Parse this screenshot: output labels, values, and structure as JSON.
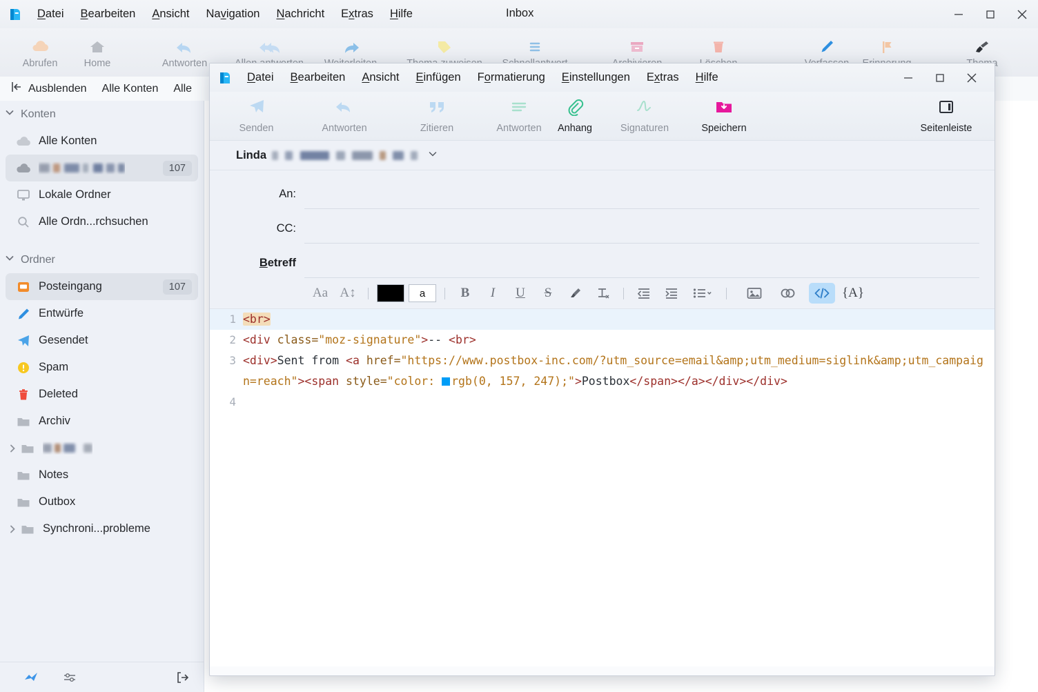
{
  "main_window": {
    "title": "Inbox",
    "menu": [
      {
        "label": "Datei",
        "accel": "D"
      },
      {
        "label": "Bearbeiten",
        "accel": "B"
      },
      {
        "label": "Ansicht",
        "accel": "A"
      },
      {
        "label": "Navigation",
        "accel": "v"
      },
      {
        "label": "Nachricht",
        "accel": "N"
      },
      {
        "label": "Extras",
        "accel": "x"
      },
      {
        "label": "Hilfe",
        "accel": "H"
      }
    ],
    "window_controls": [
      "minimize",
      "maximize",
      "close"
    ],
    "toolbar": [
      {
        "label": "Abrufen",
        "icon": "cloud-download-icon"
      },
      {
        "label": "Home",
        "icon": "home-icon"
      },
      {
        "label": "Antworten",
        "icon": "reply-icon"
      },
      {
        "label": "Allen antworten",
        "icon": "reply-all-icon"
      },
      {
        "label": "Weiterleiten",
        "icon": "forward-icon"
      },
      {
        "label": "Thema zuweisen",
        "icon": "tag-icon"
      },
      {
        "label": "Schnellantwort",
        "icon": "quick-reply-icon"
      },
      {
        "label": "Archivieren",
        "icon": "archive-icon"
      },
      {
        "label": "Löschen",
        "icon": "trash-icon"
      },
      {
        "label": "Verfassen",
        "icon": "compose-pencil-icon"
      },
      {
        "label": "Erinnerung",
        "icon": "flag-icon"
      },
      {
        "label": "Thema",
        "icon": "paintbrush-icon"
      }
    ],
    "subbar": [
      {
        "label": "Ausblenden",
        "icon": "collapse-icon"
      },
      {
        "label": "Alle Konten",
        "icon": "none"
      },
      {
        "label": "Alle",
        "icon": "none"
      }
    ],
    "sidebar": {
      "sections": [
        {
          "title": "Konten",
          "items": [
            {
              "label": "Alle Konten",
              "icon": "cloud-icon",
              "badge": "",
              "selected": false,
              "redacted": false,
              "chevron": false
            },
            {
              "label": "",
              "icon": "cloud-icon",
              "badge": "107",
              "selected": true,
              "redacted": true,
              "chevron": false
            },
            {
              "label": "Lokale Ordner",
              "icon": "monitor-icon",
              "badge": "",
              "selected": false,
              "redacted": false,
              "chevron": false
            },
            {
              "label": "Alle Ordn...rchsuchen",
              "icon": "search-icon",
              "badge": "",
              "selected": false,
              "redacted": false,
              "chevron": false
            }
          ]
        },
        {
          "title": "Ordner",
          "items": [
            {
              "label": "Posteingang",
              "icon": "inbox-icon",
              "badge": "107",
              "selected": true,
              "redacted": false,
              "chevron": false
            },
            {
              "label": "Entwürfe",
              "icon": "pencil-icon",
              "badge": "",
              "selected": false,
              "redacted": false,
              "chevron": false
            },
            {
              "label": "Gesendet",
              "icon": "sent-icon",
              "badge": "",
              "selected": false,
              "redacted": false,
              "chevron": false
            },
            {
              "label": "Spam",
              "icon": "warning-icon",
              "badge": "",
              "selected": false,
              "redacted": false,
              "chevron": false
            },
            {
              "label": "Deleted",
              "icon": "trash-icon",
              "badge": "",
              "selected": false,
              "redacted": false,
              "chevron": false
            },
            {
              "label": "Archiv",
              "icon": "folder-icon",
              "badge": "",
              "selected": false,
              "redacted": false,
              "chevron": false
            },
            {
              "label": "",
              "icon": "folder-icon",
              "badge": "",
              "selected": false,
              "redacted": true,
              "chevron": true
            },
            {
              "label": "Notes",
              "icon": "folder-icon",
              "badge": "",
              "selected": false,
              "redacted": false,
              "chevron": false
            },
            {
              "label": "Outbox",
              "icon": "folder-icon",
              "badge": "",
              "selected": false,
              "redacted": false,
              "chevron": false
            },
            {
              "label": "Synchroni...probleme",
              "icon": "folder-icon",
              "badge": "",
              "selected": false,
              "redacted": false,
              "chevron": true
            }
          ]
        }
      ]
    },
    "statusbar": [
      {
        "icon": "activity-icon"
      },
      {
        "icon": "filter-sliders-icon"
      },
      {
        "icon": "logout-icon"
      }
    ]
  },
  "compose_window": {
    "menu": [
      {
        "label": "Datei",
        "accel": "D"
      },
      {
        "label": "Bearbeiten",
        "accel": "B"
      },
      {
        "label": "Ansicht",
        "accel": "A"
      },
      {
        "label": "Einfügen",
        "accel": "E"
      },
      {
        "label": "Formatierung",
        "accel": "o"
      },
      {
        "label": "Einstellungen",
        "accel": "E"
      },
      {
        "label": "Extras",
        "accel": "x"
      },
      {
        "label": "Hilfe",
        "accel": "H"
      }
    ],
    "window_controls": [
      "minimize",
      "maximize",
      "close"
    ],
    "toolbar": [
      {
        "label": "Senden",
        "icon": "send-icon",
        "enabled": false
      },
      {
        "label": "Antworten",
        "icon": "reply-icon",
        "enabled": false
      },
      {
        "label": "Zitieren",
        "icon": "quote-icon",
        "enabled": false
      },
      {
        "label": "Antworten",
        "icon": "reply-list-icon",
        "enabled": false
      },
      {
        "label": "Anhang",
        "icon": "paperclip-icon",
        "enabled": true
      },
      {
        "label": "Signaturen",
        "icon": "signature-icon",
        "enabled": false
      },
      {
        "label": "Speichern",
        "icon": "save-folder-icon",
        "enabled": true
      },
      {
        "label": "Seitenleiste",
        "icon": "sidebar-panel-icon",
        "enabled": true
      }
    ],
    "from": {
      "name": "Linda",
      "address_redacted": true,
      "dropdown_icon": "chevron-down-icon"
    },
    "fields": [
      {
        "label": "An:",
        "value": "",
        "bold": false
      },
      {
        "label": "CC:",
        "value": "",
        "bold": false
      },
      {
        "label": "Betreff",
        "value": "",
        "bold": true,
        "accel": "B"
      }
    ],
    "format_toolbar": [
      {
        "name": "font-family-icon",
        "glyph": "Aa",
        "active": false
      },
      {
        "name": "font-size-icon",
        "glyph": "A↕",
        "active": false
      },
      {
        "name": "separator",
        "glyph": "",
        "active": false
      },
      {
        "name": "text-color-swatch",
        "glyph": "",
        "active": false
      },
      {
        "name": "highlight-color-swatch",
        "glyph": "a",
        "active": false
      },
      {
        "name": "separator",
        "glyph": "",
        "active": false
      },
      {
        "name": "bold-icon",
        "glyph": "B",
        "active": false
      },
      {
        "name": "italic-icon",
        "glyph": "I",
        "active": false
      },
      {
        "name": "underline-icon",
        "glyph": "U",
        "active": false
      },
      {
        "name": "strikethrough-icon",
        "glyph": "S",
        "active": false
      },
      {
        "name": "highlighter-icon",
        "glyph": "",
        "active": false
      },
      {
        "name": "clear-formatting-icon",
        "glyph": "Tx",
        "active": false
      },
      {
        "name": "separator",
        "glyph": "",
        "active": false
      },
      {
        "name": "outdent-icon",
        "glyph": "",
        "active": false
      },
      {
        "name": "indent-icon",
        "glyph": "",
        "active": false
      },
      {
        "name": "list-icon",
        "glyph": "",
        "active": false
      },
      {
        "name": "separator",
        "glyph": "",
        "active": false
      },
      {
        "name": "insert-image-icon",
        "glyph": "",
        "active": false
      },
      {
        "name": "insert-link-icon",
        "glyph": "",
        "active": false
      },
      {
        "name": "html-source-icon",
        "glyph": "</>",
        "active": true
      },
      {
        "name": "insert-placeholder-icon",
        "glyph": "{A}",
        "active": false
      }
    ],
    "editor": {
      "active_line": 1,
      "highlight_color": "#f4ddb9",
      "active_line_color": "#eaf3fc",
      "inline_color_swatch": "#009df7",
      "lines": [
        {
          "n": "1",
          "text": "<br>"
        },
        {
          "n": "2",
          "text": "<div class=\"moz-signature\">-- <br>"
        },
        {
          "n": "3",
          "text": "<div>Sent from <a href=\"https://www.postbox-inc.com/?utm_source=email&amp;utm_medium=siglink&amp;utm_campaign=reach\"><span style=\"color: rgb(0, 157, 247);\">Postbox</span></a></div></div>"
        },
        {
          "n": "4",
          "text": ""
        }
      ]
    }
  }
}
